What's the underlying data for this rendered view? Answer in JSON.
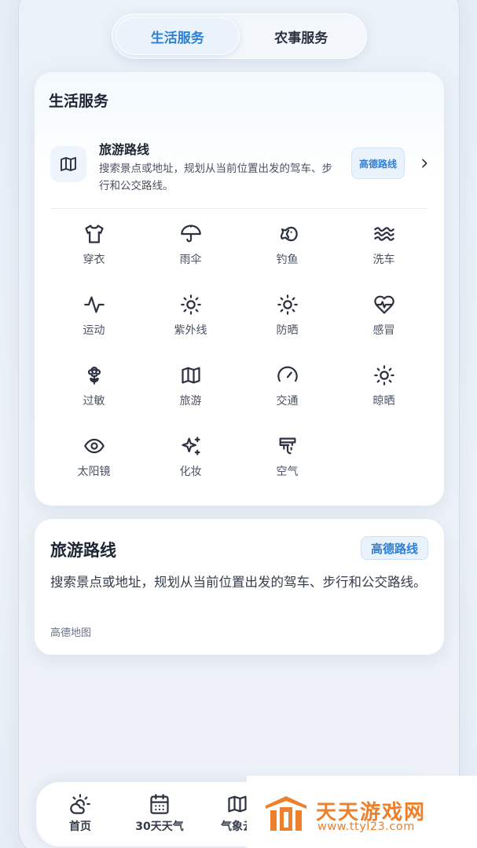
{
  "segmented": {
    "tabs": [
      "生活服务",
      "农事服务"
    ],
    "active_index": 0
  },
  "services_card": {
    "title": "生活服务",
    "featured": {
      "title": "旅游路线",
      "description": "搜索景点或地址，规划从当前位置出发的驾车、步行和公交路线。",
      "tag": "高德路线",
      "icon": "map-icon"
    },
    "items": [
      {
        "label": "穿衣",
        "icon": "shirt-icon"
      },
      {
        "label": "雨伞",
        "icon": "umbrella-icon"
      },
      {
        "label": "钓鱼",
        "icon": "fish-icon"
      },
      {
        "label": "洗车",
        "icon": "waves-icon"
      },
      {
        "label": "运动",
        "icon": "activity-icon"
      },
      {
        "label": "紫外线",
        "icon": "sun-icon"
      },
      {
        "label": "防晒",
        "icon": "sun-icon"
      },
      {
        "label": "感冒",
        "icon": "heart-pulse-icon"
      },
      {
        "label": "过敏",
        "icon": "flower-icon"
      },
      {
        "label": "旅游",
        "icon": "map-icon"
      },
      {
        "label": "交通",
        "icon": "gauge-icon"
      },
      {
        "label": "晾晒",
        "icon": "sun-icon"
      },
      {
        "label": "太阳镜",
        "icon": "eye-icon"
      },
      {
        "label": "化妆",
        "icon": "sparkles-icon"
      },
      {
        "label": "空气",
        "icon": "air-icon"
      }
    ]
  },
  "detail_card": {
    "title": "旅游路线",
    "tag": "高德路线",
    "description": "搜索景点或地址，规划从当前位置出发的驾车、步行和公交路线。",
    "source": "高德地图"
  },
  "tabbar": {
    "items": [
      {
        "label": "首页",
        "icon": "cloud-sun-icon"
      },
      {
        "label": "30天天气",
        "icon": "calendar-icon"
      },
      {
        "label": "气象云",
        "icon": "map-icon"
      }
    ]
  },
  "watermark": {
    "name": "天天游戏网",
    "url": "www.ttyl23.com"
  }
}
